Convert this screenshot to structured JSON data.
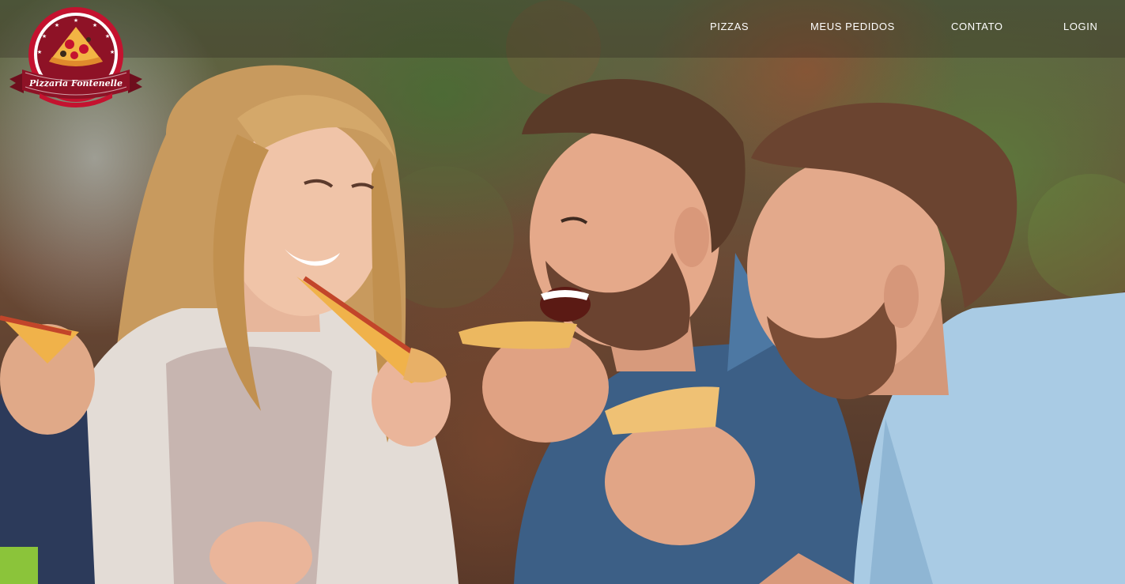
{
  "brand": {
    "name": "Pizzaria Fontenelle",
    "accent": "#c4122f",
    "ribbon": "#8e1226"
  },
  "nav": {
    "items": [
      {
        "label": "PIZZAS"
      },
      {
        "label": "MEUS PEDIDOS"
      },
      {
        "label": "CONTATO"
      },
      {
        "label": "LOGIN"
      }
    ]
  },
  "hero": {
    "image_description": "hero-photo-friends-eating-pizza"
  }
}
